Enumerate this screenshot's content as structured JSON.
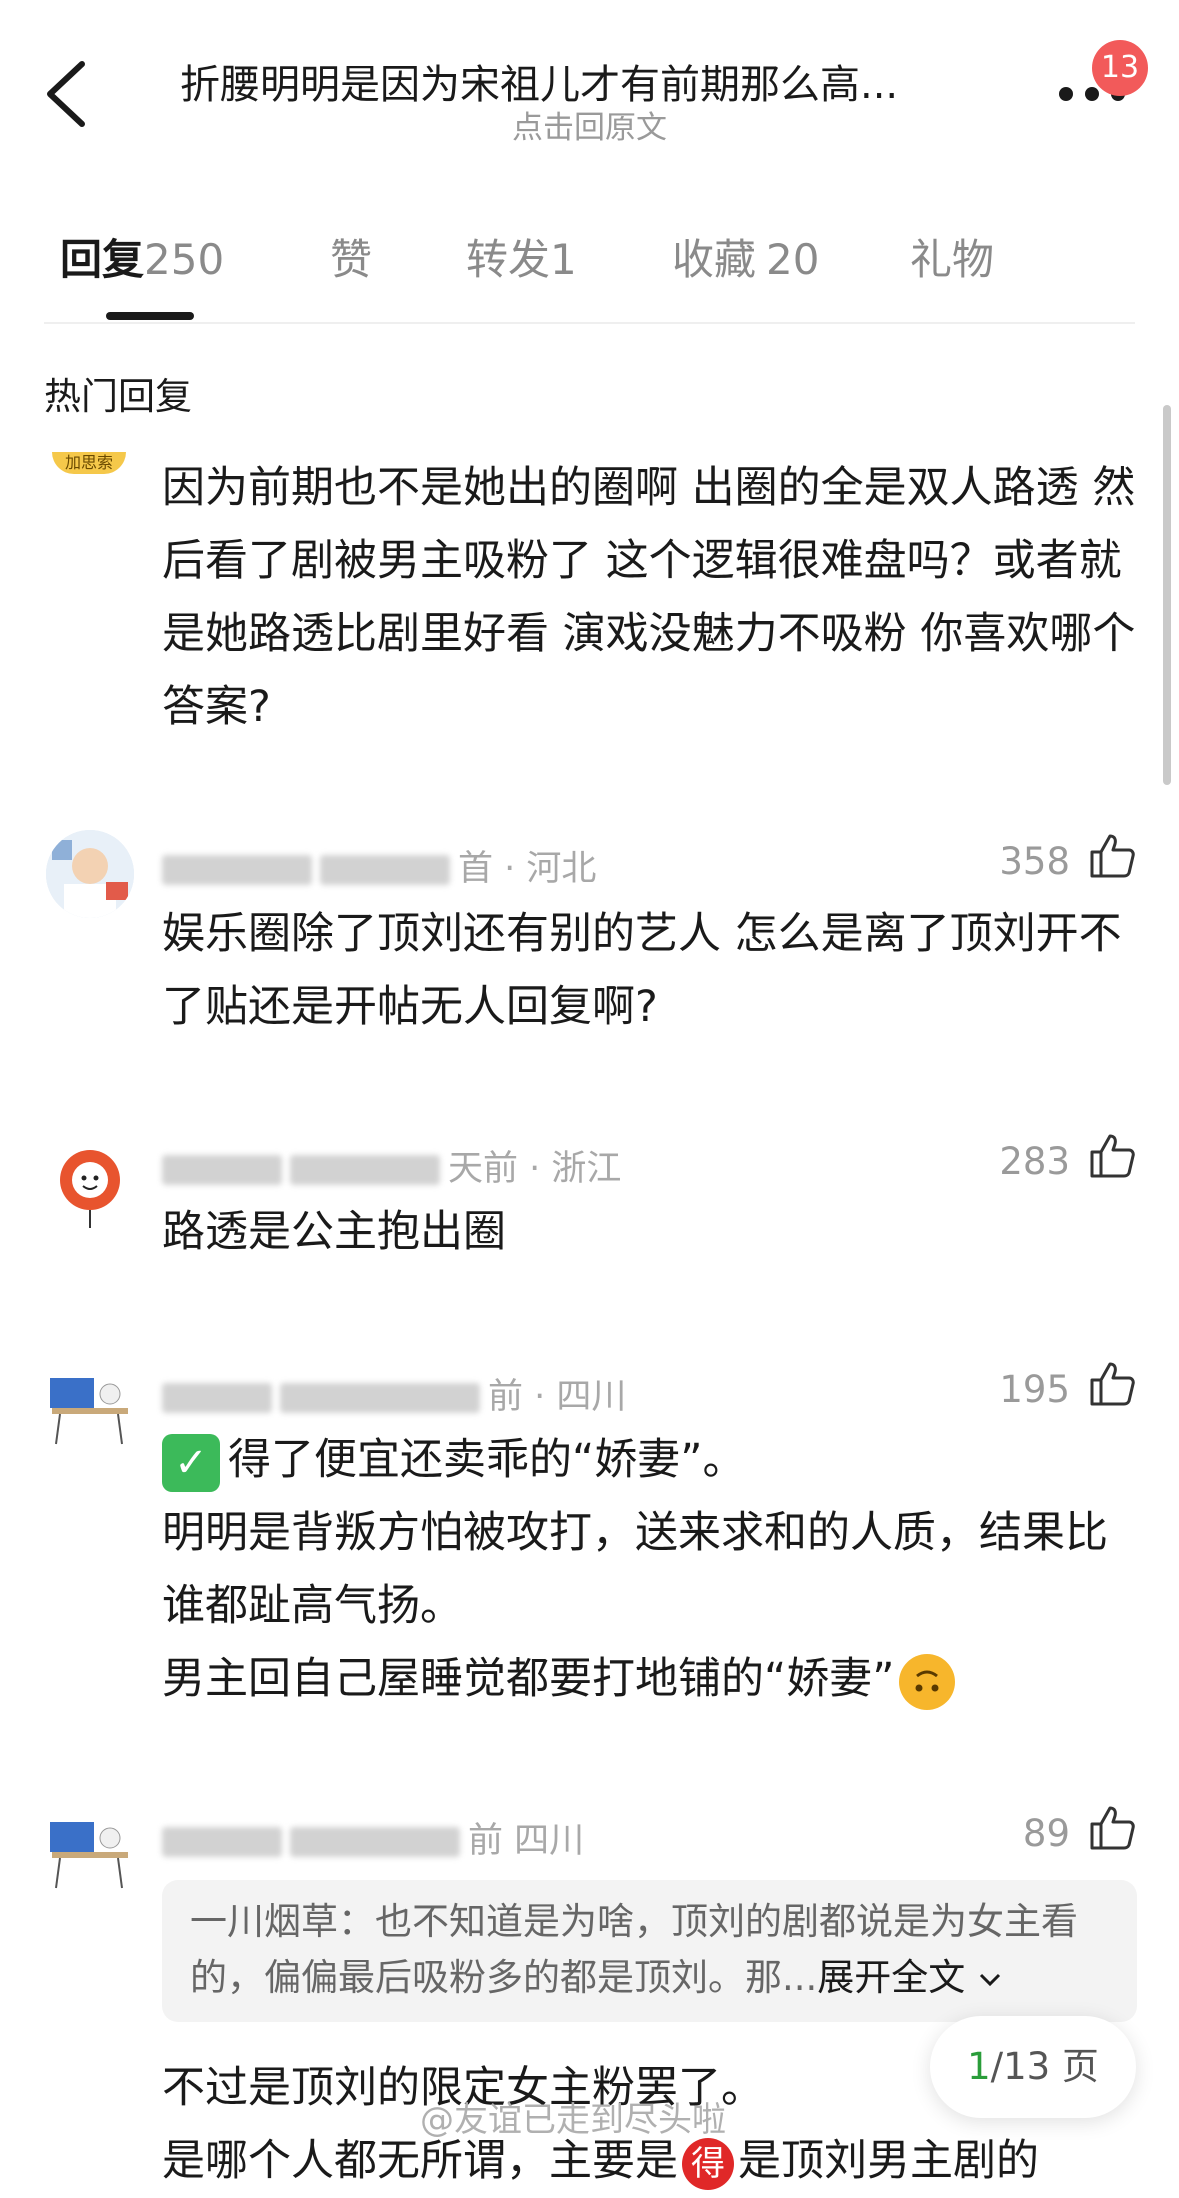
{
  "header": {
    "title": "折腰明明是因为宋祖儿才有前期那么高...",
    "subtitle": "点击回原文",
    "notification_count": "13"
  },
  "tabs": [
    {
      "label": "回复",
      "count": "250"
    },
    {
      "label": "赞",
      "count": ""
    },
    {
      "label": "转发",
      "count": "1"
    },
    {
      "label": "收藏",
      "count": "20"
    },
    {
      "label": "礼物",
      "count": ""
    }
  ],
  "section_title": "热门回复",
  "comments": [
    {
      "badge": "加思索",
      "text": "因为前期也不是她出的圈啊 出圈的全是双人路透 然后看了剧被男主吸粉了 这个逻辑很难盘吗？或者就是她路透比剧里好看 演戏没魅力不吸粉 你喜欢哪个答案?"
    },
    {
      "meta_suffix": "首 · 河北",
      "likes": "358",
      "text": "娱乐圈除了顶刘还有别的艺人 怎么是离了顶刘开不了贴还是开帖无人回复啊?"
    },
    {
      "meta_suffix": "天前 · 浙江",
      "likes": "283",
      "text": "路透是公主抱出圈"
    },
    {
      "meta_suffix": "前 · 四川",
      "likes": "195",
      "line1": "得了便宜还卖乖的“娇妻”。",
      "line2": "明明是背叛方怕被攻打，送来求和的人质，结果比谁都趾高气扬。",
      "line3": "男主回自己屋睡觉都要打地铺的“娇妻”"
    },
    {
      "meta_suffix": "前 四川",
      "likes": "89",
      "quote_author": "一川烟草：",
      "quote_text": "也不知道是为啥，顶刘的剧都说是为女主看的，偏偏最后吸粉多的都是顶刘。那...",
      "quote_expand": "展开全文",
      "line1": "不过是顶刘的限定女主粉罢了。",
      "line2_a": "是哪个人都无所谓，主要是",
      "line2_icon": "得",
      "line2_b": "是顶刘男主剧的"
    }
  ],
  "pager": {
    "current": "1",
    "total": "/13 页"
  },
  "watermark": "@友谊已走到尽头啦",
  "colors": {
    "badge": "#f25a5a",
    "pager_current": "#2a9d3a",
    "check": "#3cba5a"
  }
}
